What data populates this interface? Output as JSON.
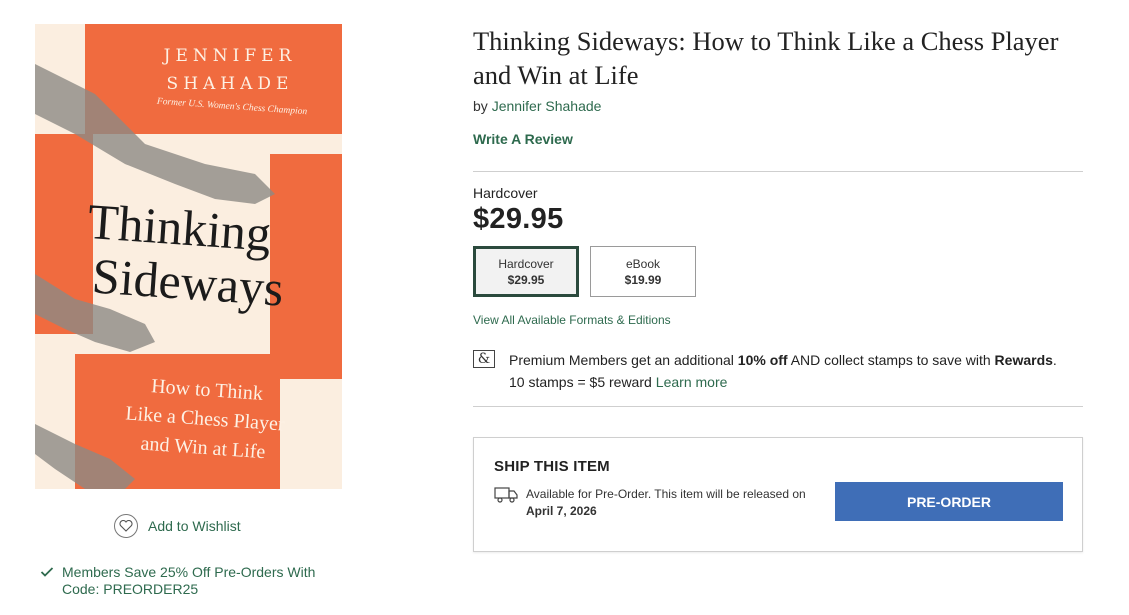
{
  "cover": {
    "author_line1": "JENNIFER",
    "author_line2": "SHAHADE",
    "tagline": "Former U.S. Women's Chess Champion",
    "title_line1": "Thinking",
    "title_line2": "Sideways",
    "subtitle_line1": "How to Think",
    "subtitle_line2": "Like a Chess Player",
    "subtitle_line3": "and Win at Life",
    "colors": {
      "orange": "#f06b3f",
      "cream": "#fbeee0"
    }
  },
  "wishlist": {
    "label": "Add to Wishlist",
    "icon": "heart-icon"
  },
  "promo": {
    "text": "Members Save 25% Off Pre-Orders With Code: PREORDER25",
    "icon": "check-icon"
  },
  "product": {
    "title": "Thinking Sideways: How to Think Like a Chess Player and Win at Life",
    "by": "by",
    "author": "Jennifer Shahade",
    "write_review": "Write A Review",
    "selected_format": "Hardcover",
    "price": "$29.95"
  },
  "formats": [
    {
      "name": "Hardcover",
      "price": "$29.95",
      "selected": true
    },
    {
      "name": "eBook",
      "price": "$19.99",
      "selected": false
    }
  ],
  "view_all": "View All Available Formats & Editions",
  "members": {
    "icon": "ampersand-icon",
    "line1_a": "Premium Members get an additional ",
    "line1_b": "10% off",
    "line1_c": " AND collect stamps to save with ",
    "line1_d": "Rewards",
    "line1_e": ".",
    "line2": "10 stamps = $5 reward",
    "learn_more": "Learn more"
  },
  "ship": {
    "title": "SHIP THIS ITEM",
    "note": "Available for Pre-Order. This item will be released on",
    "date": "April 7, 2026",
    "button": "PRE-ORDER",
    "icon": "truck-icon"
  },
  "colors": {
    "accent_green": "#2e6a4e",
    "button_blue": "#3f6eb7",
    "selected_border": "#2b4a3d"
  }
}
